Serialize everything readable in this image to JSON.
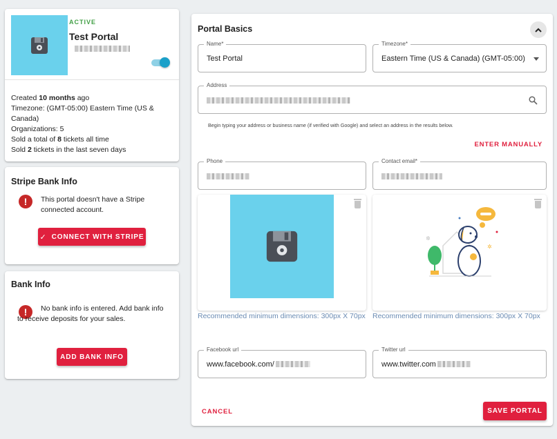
{
  "portal_card": {
    "status": "ACTIVE",
    "name": "Test Portal",
    "created": {
      "prefix": "Created ",
      "bold": "10 months",
      "suffix": " ago"
    },
    "timezone": "Timezone: (GMT-05:00) Eastern Time (US & Canada)",
    "organizations": "Organizations: 5",
    "sold_total": {
      "prefix": "Sold a total of ",
      "bold": "8",
      "suffix": " tickets all time"
    },
    "sold_recent": {
      "prefix": "Sold ",
      "bold": "2",
      "suffix": " tickets in the last seven days"
    },
    "toggle_on": true
  },
  "stripe_card": {
    "title": "Stripe Bank Info",
    "message": "This portal doesn't have a Stripe connected account.",
    "button": "CONNECT WITH STRIPE"
  },
  "bank_card": {
    "title": "Bank Info",
    "message": "No bank info is entered. Add bank info to receive deposits for your sales.",
    "button": "ADD BANK INFO"
  },
  "basics": {
    "title": "Portal Basics",
    "name_label": "Name*",
    "name_value": "Test Portal",
    "timezone_label": "Timezone*",
    "timezone_value": "Eastern Time (US & Canada) (GMT-05:00)",
    "address_label": "Address",
    "address_hint": "Begin typing your address or business name (if verified with Google) and select an address in the results below.",
    "enter_manually": "ENTER MANUALLY",
    "phone_label": "Phone",
    "email_label": "Contact email*",
    "dimensions_hint_1": "Recommended minimum dimensions: 300px X 70px",
    "dimensions_hint_2": "Recommended minimum dimensions: 300px X 70px",
    "facebook_label": "Facebook url",
    "facebook_value": "www.facebook.com/",
    "twitter_label": "Twitter url",
    "twitter_value": "www.twitter.com",
    "cancel": "CANCEL",
    "save": "SAVE PORTAL"
  },
  "colors": {
    "accent_red": "#e0203e",
    "active_green": "#43a047",
    "toggle_teal": "#1ba0c9",
    "logo_bg": "#6ad1ec",
    "hint_blue": "#6a8bb3"
  },
  "icons": {
    "logo": "floppy-disk-icon",
    "search": "search-icon",
    "delete": "trash-icon",
    "alert": "error-icon",
    "check": "check-icon",
    "collapse": "chevron-up-icon",
    "dropdown": "caret-down-icon"
  }
}
